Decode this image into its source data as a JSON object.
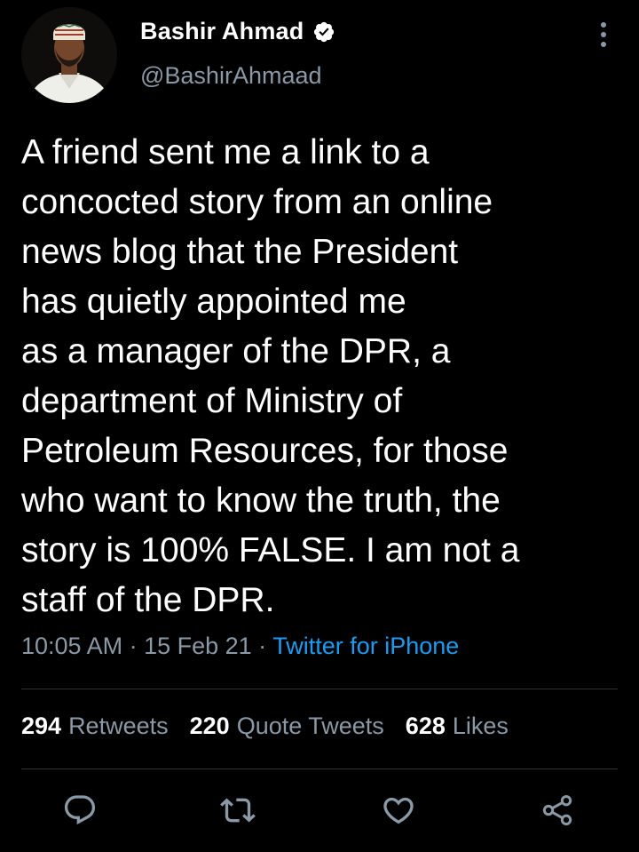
{
  "author": {
    "display_name": "Bashir Ahmad",
    "handle": "@BashirAhmaad",
    "verified": true
  },
  "tweet": {
    "text": "A friend sent me a link to a\nconcocted story from an online\nnews blog that the President\nhas quietly appointed me\nas a manager of the DPR, a\ndepartment of Ministry of\nPetroleum Resources, for those\nwho want to know the truth, the\nstory is 100% FALSE. I am not a\nstaff of the DPR.",
    "time": "10:05 AM",
    "date": "15 Feb 21",
    "separator": " · ",
    "source": "Twitter for iPhone"
  },
  "stats": {
    "retweets_count": "294",
    "retweets_label": "Retweets",
    "quotes_count": "220",
    "quotes_label": "Quote Tweets",
    "likes_count": "628",
    "likes_label": "Likes"
  },
  "icons": {
    "more": "more-vertical-icon",
    "verified": "verified-badge-icon",
    "reply": "reply-icon",
    "retweet": "retweet-icon",
    "like": "heart-icon",
    "share": "share-icon"
  },
  "colors": {
    "background": "#000000",
    "text": "#ffffff",
    "secondary": "#8b98a5",
    "link": "#1d9bf0",
    "divider": "#2f3336"
  }
}
